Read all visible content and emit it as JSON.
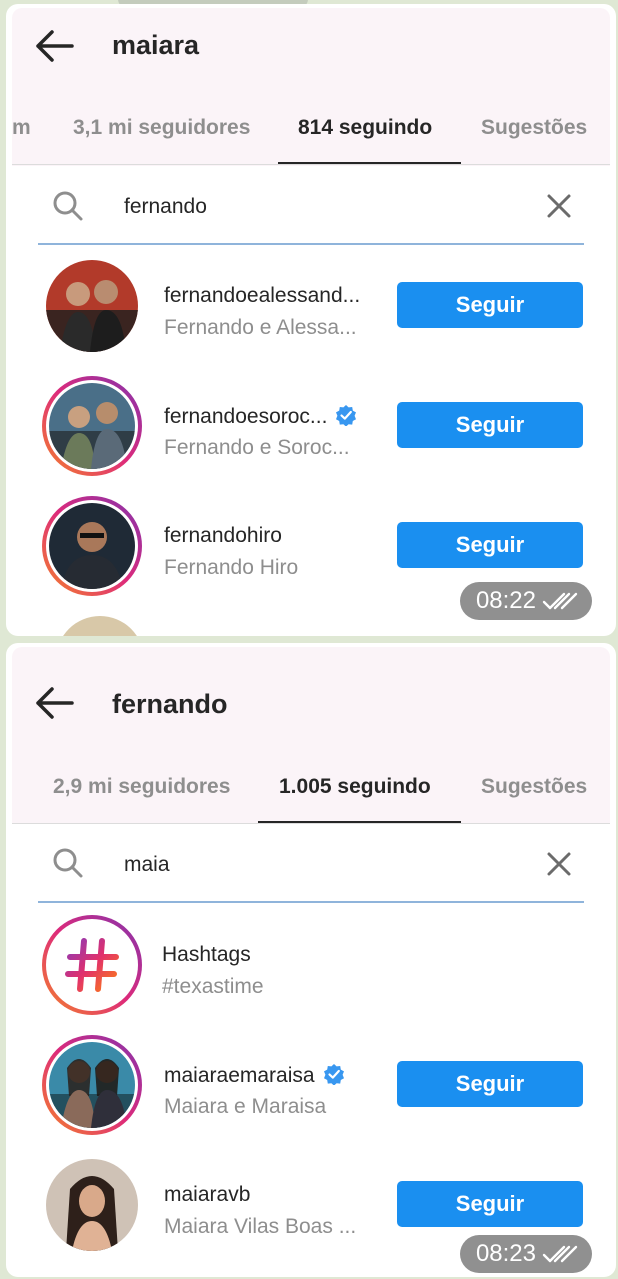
{
  "screenshots": [
    {
      "title": "maiara",
      "tabs": [
        {
          "label": "m",
          "active": false
        },
        {
          "label": "3,1 mi seguidores",
          "active": false
        },
        {
          "label": "814 seguindo",
          "active": true
        },
        {
          "label": "Sugestões",
          "active": false
        }
      ],
      "search_value": "fernando",
      "results": [
        {
          "username": "fernandoealessand...",
          "full_name": "Fernando e Alessa...",
          "verified": false,
          "story_ring": false,
          "button": "Seguir"
        },
        {
          "username": "fernandoesoroc...",
          "full_name": "Fernando e Soroc...",
          "verified": true,
          "story_ring": true,
          "button": "Seguir"
        },
        {
          "username": "fernandohiro",
          "full_name": "Fernando Hiro",
          "verified": false,
          "story_ring": true,
          "button": "Seguir"
        }
      ],
      "timestamp": "08:22"
    },
    {
      "title": "fernando",
      "tabs": [
        {
          "label": "2,9 mi seguidores",
          "active": false
        },
        {
          "label": "1.005 seguindo",
          "active": true
        },
        {
          "label": "Sugestões",
          "active": false
        }
      ],
      "search_value": "maia",
      "hashtag_row": {
        "label": "Hashtags",
        "value": "#texastime"
      },
      "results": [
        {
          "username": "maiaraemaraisa",
          "full_name": "Maiara e Maraisa",
          "verified": true,
          "story_ring": true,
          "button": "Seguir"
        },
        {
          "username": "maiaravb",
          "full_name": "Maiara Vilas Boas ...",
          "verified": false,
          "story_ring": false,
          "button": "Seguir"
        }
      ],
      "timestamp": "08:23"
    }
  ],
  "colors": {
    "follow_button": "#1a8ff0",
    "verified": "#3897f0",
    "chat_background": "#dfe8d4"
  }
}
